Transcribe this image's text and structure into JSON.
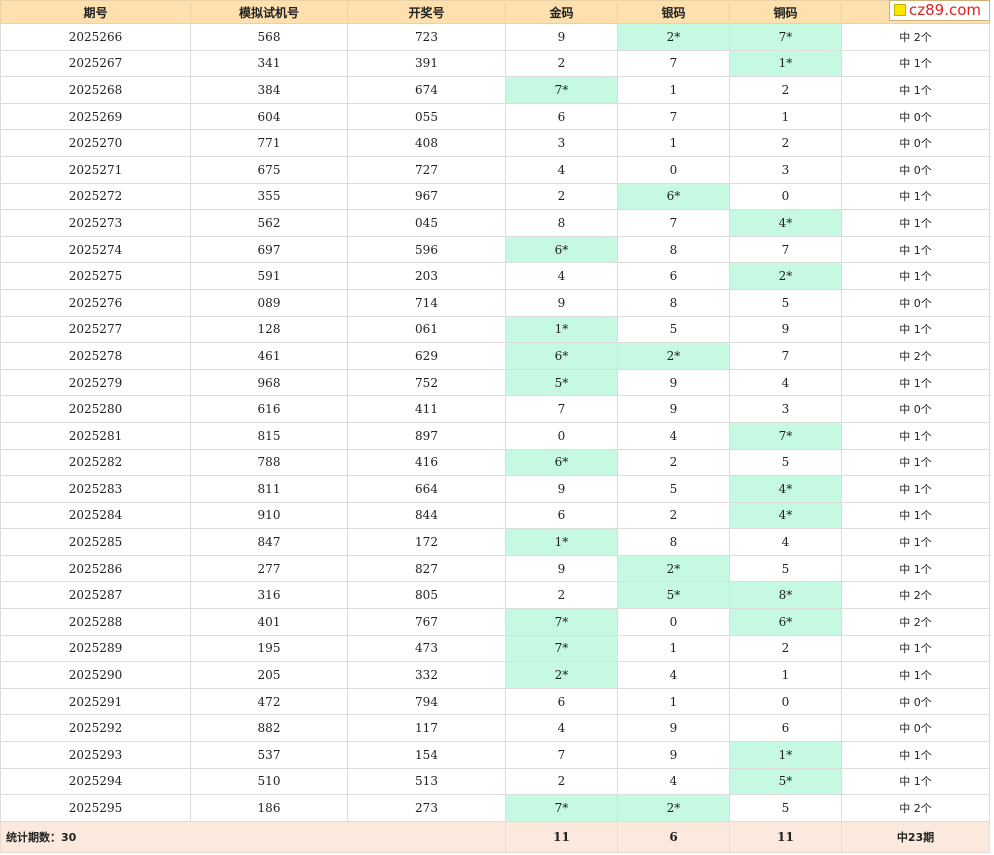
{
  "logo": {
    "text": "cz89.com"
  },
  "header": {
    "cols": [
      "期号",
      "模拟试机号",
      "开奖号",
      "金码",
      "银码",
      "铜码",
      ""
    ]
  },
  "rows": [
    {
      "issue": "2025266",
      "sim": "568",
      "draw": "723",
      "gold": "9",
      "silver": "2*",
      "copper": "7*",
      "result": "中 2个"
    },
    {
      "issue": "2025267",
      "sim": "341",
      "draw": "391",
      "gold": "2",
      "silver": "7",
      "copper": "1*",
      "result": "中 1个"
    },
    {
      "issue": "2025268",
      "sim": "384",
      "draw": "674",
      "gold": "7*",
      "silver": "1",
      "copper": "2",
      "result": "中 1个"
    },
    {
      "issue": "2025269",
      "sim": "604",
      "draw": "055",
      "gold": "6",
      "silver": "7",
      "copper": "1",
      "result": "中 0个"
    },
    {
      "issue": "2025270",
      "sim": "771",
      "draw": "408",
      "gold": "3",
      "silver": "1",
      "copper": "2",
      "result": "中 0个"
    },
    {
      "issue": "2025271",
      "sim": "675",
      "draw": "727",
      "gold": "4",
      "silver": "0",
      "copper": "3",
      "result": "中 0个"
    },
    {
      "issue": "2025272",
      "sim": "355",
      "draw": "967",
      "gold": "2",
      "silver": "6*",
      "copper": "0",
      "result": "中 1个"
    },
    {
      "issue": "2025273",
      "sim": "562",
      "draw": "045",
      "gold": "8",
      "silver": "7",
      "copper": "4*",
      "result": "中 1个"
    },
    {
      "issue": "2025274",
      "sim": "697",
      "draw": "596",
      "gold": "6*",
      "silver": "8",
      "copper": "7",
      "result": "中 1个"
    },
    {
      "issue": "2025275",
      "sim": "591",
      "draw": "203",
      "gold": "4",
      "silver": "6",
      "copper": "2*",
      "result": "中 1个"
    },
    {
      "issue": "2025276",
      "sim": "089",
      "draw": "714",
      "gold": "9",
      "silver": "8",
      "copper": "5",
      "result": "中 0个"
    },
    {
      "issue": "2025277",
      "sim": "128",
      "draw": "061",
      "gold": "1*",
      "silver": "5",
      "copper": "9",
      "result": "中 1个"
    },
    {
      "issue": "2025278",
      "sim": "461",
      "draw": "629",
      "gold": "6*",
      "silver": "2*",
      "copper": "7",
      "result": "中 2个"
    },
    {
      "issue": "2025279",
      "sim": "968",
      "draw": "752",
      "gold": "5*",
      "silver": "9",
      "copper": "4",
      "result": "中 1个"
    },
    {
      "issue": "2025280",
      "sim": "616",
      "draw": "411",
      "gold": "7",
      "silver": "9",
      "copper": "3",
      "result": "中 0个"
    },
    {
      "issue": "2025281",
      "sim": "815",
      "draw": "897",
      "gold": "0",
      "silver": "4",
      "copper": "7*",
      "result": "中 1个"
    },
    {
      "issue": "2025282",
      "sim": "788",
      "draw": "416",
      "gold": "6*",
      "silver": "2",
      "copper": "5",
      "result": "中 1个"
    },
    {
      "issue": "2025283",
      "sim": "811",
      "draw": "664",
      "gold": "9",
      "silver": "5",
      "copper": "4*",
      "result": "中 1个"
    },
    {
      "issue": "2025284",
      "sim": "910",
      "draw": "844",
      "gold": "6",
      "silver": "2",
      "copper": "4*",
      "result": "中 1个"
    },
    {
      "issue": "2025285",
      "sim": "847",
      "draw": "172",
      "gold": "1*",
      "silver": "8",
      "copper": "4",
      "result": "中 1个"
    },
    {
      "issue": "2025286",
      "sim": "277",
      "draw": "827",
      "gold": "9",
      "silver": "2*",
      "copper": "5",
      "result": "中 1个"
    },
    {
      "issue": "2025287",
      "sim": "316",
      "draw": "805",
      "gold": "2",
      "silver": "5*",
      "copper": "8*",
      "result": "中 2个"
    },
    {
      "issue": "2025288",
      "sim": "401",
      "draw": "767",
      "gold": "7*",
      "silver": "0",
      "copper": "6*",
      "result": "中 2个"
    },
    {
      "issue": "2025289",
      "sim": "195",
      "draw": "473",
      "gold": "7*",
      "silver": "1",
      "copper": "2",
      "result": "中 1个"
    },
    {
      "issue": "2025290",
      "sim": "205",
      "draw": "332",
      "gold": "2*",
      "silver": "4",
      "copper": "1",
      "result": "中 1个"
    },
    {
      "issue": "2025291",
      "sim": "472",
      "draw": "794",
      "gold": "6",
      "silver": "1",
      "copper": "0",
      "result": "中 0个"
    },
    {
      "issue": "2025292",
      "sim": "882",
      "draw": "117",
      "gold": "4",
      "silver": "9",
      "copper": "6",
      "result": "中 0个"
    },
    {
      "issue": "2025293",
      "sim": "537",
      "draw": "154",
      "gold": "7",
      "silver": "9",
      "copper": "1*",
      "result": "中 1个"
    },
    {
      "issue": "2025294",
      "sim": "510",
      "draw": "513",
      "gold": "2",
      "silver": "4",
      "copper": "5*",
      "result": "中 1个"
    },
    {
      "issue": "2025295",
      "sim": "186",
      "draw": "273",
      "gold": "7*",
      "silver": "2*",
      "copper": "5",
      "result": "中 2个"
    }
  ],
  "footer": {
    "label": "统计期数：30",
    "gold": "11",
    "silver": "6",
    "copper": "11",
    "total": "中23期"
  },
  "colors": {
    "header_bg": "#fde0ad",
    "hit_bg": "#c5f9e2",
    "footer_bg": "#fae9dc",
    "logo_text": "#dd2222"
  }
}
